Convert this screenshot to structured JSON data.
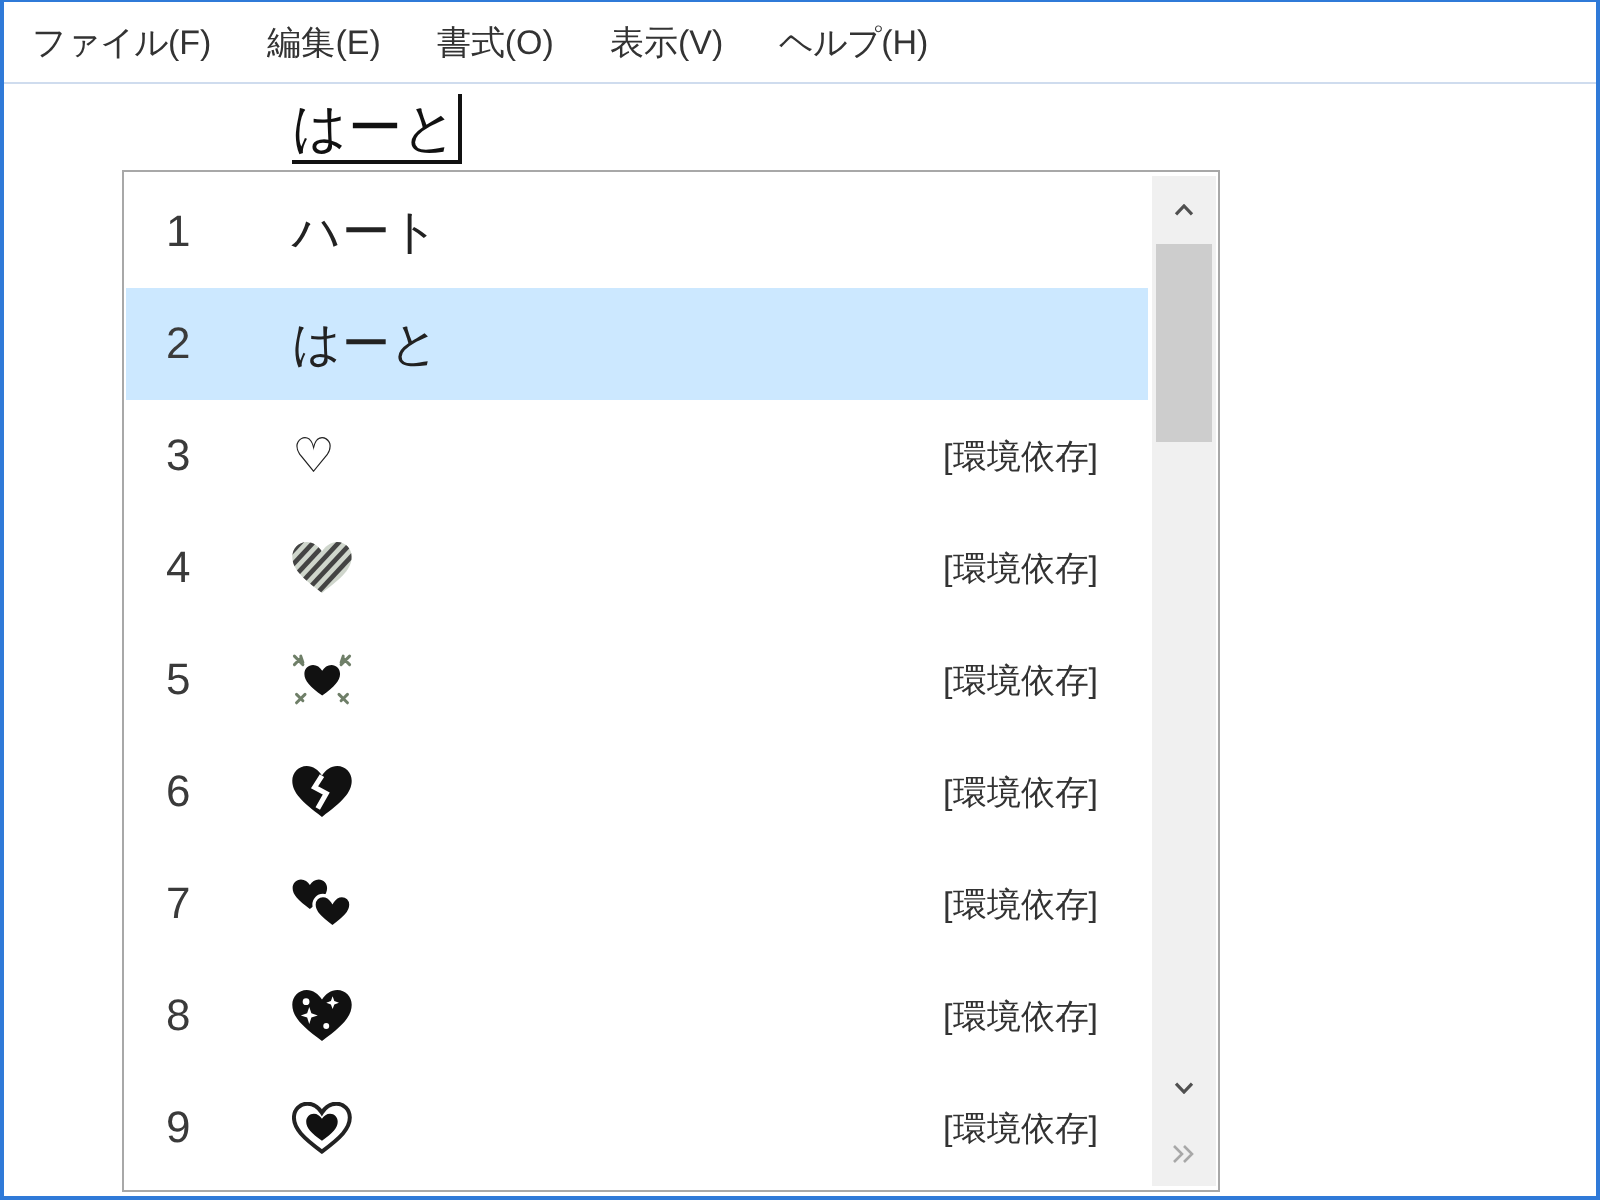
{
  "menu": [
    "ファイル(F)",
    "編集(E)",
    "書式(O)",
    "表示(V)",
    "ヘルプ(H)"
  ],
  "composition": {
    "text": "はーと"
  },
  "candidates": [
    {
      "number": "1",
      "kind": "text",
      "text": "ハート",
      "selected": false
    },
    {
      "number": "2",
      "kind": "text",
      "text": "はーと",
      "selected": true
    },
    {
      "number": "3",
      "kind": "text",
      "text": "♡",
      "note": "[環境依存]",
      "selected": false
    },
    {
      "number": "4",
      "kind": "striped",
      "note": "[環境依存]",
      "selected": false
    },
    {
      "number": "5",
      "kind": "decorated",
      "note": "[環境依存]",
      "selected": false
    },
    {
      "number": "6",
      "kind": "broken",
      "note": "[環境依存]",
      "selected": false
    },
    {
      "number": "7",
      "kind": "double",
      "note": "[環境依存]",
      "selected": false
    },
    {
      "number": "8",
      "kind": "sparkling",
      "note": "[環境依存]",
      "selected": false
    },
    {
      "number": "9",
      "kind": "framed",
      "note": "[環境依存]",
      "selected": false
    }
  ]
}
